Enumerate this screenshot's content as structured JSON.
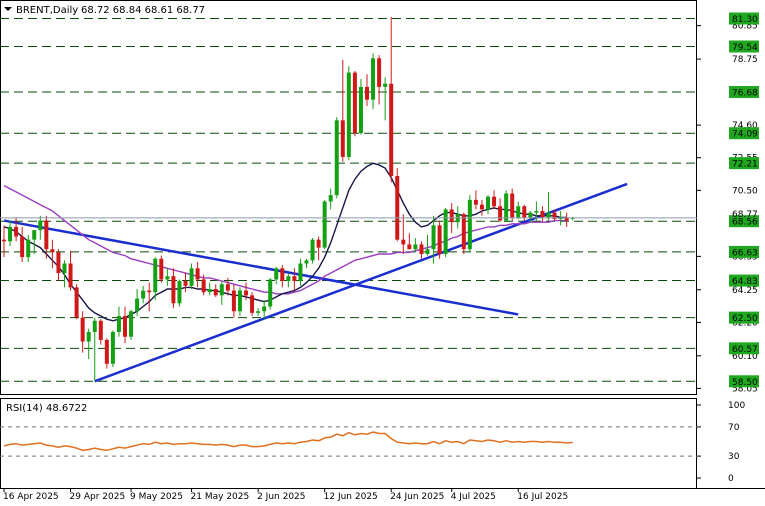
{
  "header": {
    "symbol_label": "BRENT,Daily",
    "ohlc": "68.72 68.84 68.61 68.77"
  },
  "rsi_panel": {
    "label": "RSI(14) 48.6722"
  },
  "colors": {
    "up": "#13a013",
    "down": "#d01818",
    "trendline": "#1a2ed0",
    "ma_fast": "#151548",
    "ma_slow": "#9a3cc0",
    "rsi": "#e07020",
    "level_line": "#0a4a0a",
    "tag_bg": "#1fa81f"
  },
  "chart_data": {
    "type": "candlestick",
    "title": "BRENT,Daily",
    "y_axis_price_ticks": [
      "80.85",
      "78.75",
      "74.60",
      "72.55",
      "70.50",
      "66.35",
      "64.25",
      "62.20",
      "60.10",
      "58.05"
    ],
    "level_tags": [
      "81.30",
      "79.54",
      "76.68",
      "74.09",
      "72.21",
      "68.56",
      "66.63",
      "64.83",
      "62.50",
      "60.57",
      "58.50"
    ],
    "levels": [
      81.3,
      79.54,
      76.68,
      74.09,
      72.21,
      68.56,
      66.63,
      64.83,
      62.5,
      60.57,
      58.5
    ],
    "current_price_label": "68.77",
    "x_tick_labels": [
      "16 Apr 2025",
      "29 Apr 2025",
      "9 May 2025",
      "21 May 2025",
      "2 Jun 2025",
      "12 Jun 2025",
      "24 Jun 2025",
      "4 Jul 2025",
      "16 Jul 2025"
    ],
    "ohlc": [
      [
        67.4,
        68.3,
        66.3,
        67.3
      ],
      [
        67.3,
        68.6,
        67.0,
        68.2
      ],
      [
        68.2,
        68.8,
        67.3,
        67.6
      ],
      [
        67.6,
        68.2,
        66.0,
        66.3
      ],
      [
        66.3,
        67.7,
        66.0,
        67.4
      ],
      [
        67.4,
        68.0,
        66.5,
        68.0
      ],
      [
        68.0,
        68.9,
        67.4,
        68.6
      ],
      [
        68.6,
        68.9,
        66.2,
        66.8
      ],
      [
        66.8,
        67.4,
        65.6,
        66.6
      ],
      [
        66.6,
        66.8,
        64.8,
        65.3
      ],
      [
        65.3,
        66.1,
        64.4,
        65.9
      ],
      [
        65.9,
        66.7,
        64.2,
        64.4
      ],
      [
        64.4,
        64.6,
        62.4,
        62.5
      ],
      [
        62.5,
        62.9,
        60.3,
        61.0
      ],
      [
        61.0,
        61.8,
        59.9,
        61.6
      ],
      [
        61.6,
        62.5,
        58.5,
        62.3
      ],
      [
        62.3,
        62.4,
        60.8,
        61.1
      ],
      [
        61.1,
        61.2,
        59.3,
        59.6
      ],
      [
        59.6,
        61.7,
        59.4,
        61.6
      ],
      [
        61.6,
        63.2,
        61.3,
        62.6
      ],
      [
        62.6,
        63.2,
        60.9,
        61.3
      ],
      [
        61.3,
        63.0,
        61.1,
        62.9
      ],
      [
        62.9,
        64.3,
        62.6,
        63.7
      ],
      [
        63.7,
        64.5,
        63.4,
        64.2
      ],
      [
        64.2,
        64.7,
        62.9,
        64.1
      ],
      [
        64.1,
        66.3,
        63.6,
        66.2
      ],
      [
        66.2,
        66.4,
        64.7,
        64.9
      ],
      [
        64.9,
        65.6,
        64.5,
        65.1
      ],
      [
        65.1,
        65.6,
        63.1,
        63.4
      ],
      [
        63.4,
        64.9,
        63.2,
        64.8
      ],
      [
        64.8,
        65.3,
        64.1,
        64.5
      ],
      [
        64.5,
        65.9,
        64.3,
        65.6
      ],
      [
        65.6,
        66.0,
        64.4,
        64.9
      ],
      [
        64.9,
        65.2,
        63.9,
        64.1
      ],
      [
        64.1,
        64.7,
        63.9,
        64.3
      ],
      [
        64.3,
        64.6,
        63.8,
        63.9
      ],
      [
        63.9,
        64.8,
        63.3,
        64.6
      ],
      [
        64.6,
        65.0,
        63.9,
        64.2
      ],
      [
        64.2,
        64.6,
        62.5,
        62.9
      ],
      [
        62.9,
        64.4,
        62.6,
        64.2
      ],
      [
        64.2,
        64.7,
        63.6,
        63.9
      ],
      [
        63.9,
        64.1,
        62.6,
        62.8
      ],
      [
        62.8,
        63.1,
        62.6,
        62.9
      ],
      [
        62.9,
        63.6,
        62.4,
        63.2
      ],
      [
        63.2,
        65.0,
        63.0,
        64.9
      ],
      [
        64.9,
        65.7,
        64.6,
        65.6
      ],
      [
        65.6,
        65.8,
        64.4,
        64.8
      ],
      [
        64.8,
        65.3,
        64.4,
        65.1
      ],
      [
        65.1,
        65.6,
        64.2,
        64.8
      ],
      [
        64.8,
        66.2,
        64.5,
        65.9
      ],
      [
        65.9,
        66.2,
        65.6,
        66.1
      ],
      [
        66.1,
        67.5,
        65.9,
        67.4
      ],
      [
        67.4,
        67.6,
        66.1,
        66.9
      ],
      [
        66.9,
        69.9,
        66.8,
        69.8
      ],
      [
        69.8,
        70.6,
        69.3,
        70.2
      ],
      [
        70.2,
        75.1,
        70.0,
        74.9
      ],
      [
        74.9,
        78.7,
        72.3,
        72.6
      ],
      [
        72.6,
        78.3,
        72.4,
        77.9
      ],
      [
        77.9,
        78.0,
        73.9,
        74.1
      ],
      [
        74.1,
        77.5,
        74.0,
        77.0
      ],
      [
        77.0,
        77.8,
        75.8,
        76.2
      ],
      [
        76.2,
        79.1,
        75.6,
        78.8
      ],
      [
        78.8,
        79.0,
        75.9,
        77.0
      ],
      [
        77.0,
        77.6,
        74.9,
        77.2
      ],
      [
        77.2,
        81.4,
        71.0,
        71.4
      ],
      [
        71.4,
        71.9,
        67.3,
        67.4
      ],
      [
        67.4,
        69.0,
        66.5,
        67.1
      ],
      [
        67.1,
        67.8,
        66.8,
        66.8
      ],
      [
        66.8,
        67.5,
        66.6,
        67.1
      ],
      [
        67.1,
        67.3,
        66.2,
        66.5
      ],
      [
        66.5,
        67.7,
        66.4,
        66.8
      ],
      [
        66.8,
        68.9,
        65.9,
        68.3
      ],
      [
        68.3,
        68.6,
        66.2,
        66.5
      ],
      [
        66.5,
        69.4,
        66.3,
        69.3
      ],
      [
        69.3,
        69.7,
        67.8,
        68.5
      ],
      [
        68.5,
        69.5,
        68.1,
        69.0
      ],
      [
        69.0,
        69.1,
        66.5,
        66.8
      ],
      [
        66.8,
        70.2,
        66.6,
        69.9
      ],
      [
        69.9,
        70.5,
        69.3,
        69.6
      ],
      [
        69.6,
        69.9,
        68.9,
        69.3
      ],
      [
        69.3,
        70.2,
        69.0,
        70.1
      ],
      [
        70.1,
        70.5,
        69.3,
        69.5
      ],
      [
        69.5,
        70.0,
        68.5,
        68.6
      ],
      [
        68.6,
        70.5,
        68.5,
        70.3
      ],
      [
        70.3,
        70.6,
        68.6,
        68.8
      ],
      [
        68.8,
        69.8,
        68.7,
        69.5
      ],
      [
        69.5,
        69.6,
        68.6,
        68.8
      ],
      [
        68.8,
        69.2,
        68.5,
        69.1
      ],
      [
        69.1,
        69.8,
        68.6,
        69.2
      ],
      [
        69.2,
        69.5,
        68.5,
        68.8
      ],
      [
        68.8,
        70.4,
        68.6,
        69.1
      ],
      [
        69.1,
        69.3,
        68.6,
        68.7
      ],
      [
        68.7,
        69.2,
        68.3,
        68.8
      ],
      [
        68.8,
        69.1,
        68.2,
        68.6
      ],
      [
        68.72,
        68.84,
        68.61,
        68.77
      ]
    ],
    "rsi": {
      "name": "RSI(14)",
      "value": 48.6722,
      "levels": [
        70,
        30
      ],
      "ticks": [
        "100",
        "70",
        "30",
        "0"
      ],
      "values": [
        44,
        46,
        47,
        45,
        46,
        47,
        48,
        45,
        44,
        42,
        44,
        43,
        41,
        38,
        39,
        41,
        39,
        38,
        40,
        42,
        41,
        43,
        45,
        47,
        46,
        49,
        47,
        48,
        46,
        47,
        47,
        48,
        47,
        46,
        46,
        45,
        46,
        45,
        43,
        45,
        45,
        43,
        43,
        44,
        46,
        48,
        47,
        48,
        47,
        49,
        50,
        52,
        51,
        55,
        56,
        60,
        58,
        62,
        59,
        61,
        60,
        63,
        61,
        61,
        54,
        49,
        48,
        47,
        48,
        47,
        47,
        50,
        47,
        51,
        49,
        50,
        47,
        52,
        51,
        50,
        52,
        51,
        49,
        51,
        49,
        50,
        49,
        50,
        50,
        49,
        50,
        49,
        49,
        48,
        48.6722
      ]
    },
    "ma_fast": [
      68.2,
      68.1,
      67.9,
      67.6,
      67.3,
      67.1,
      66.9,
      66.5,
      66.1,
      65.7,
      65.2,
      64.6,
      64.1,
      63.6,
      63.1,
      62.8,
      62.6,
      62.4,
      62.3,
      62.4,
      62.5,
      62.7,
      62.9,
      63.2,
      63.5,
      63.9,
      64.1,
      64.3,
      64.3,
      64.3,
      64.4,
      64.4,
      64.3,
      64.3,
      64.2,
      64.2,
      64.1,
      64.0,
      63.9,
      63.9,
      63.8,
      63.7,
      63.6,
      63.5,
      63.6,
      63.8,
      64.0,
      64.1,
      64.2,
      64.4,
      64.7,
      65.1,
      65.6,
      66.3,
      67.2,
      68.3,
      69.4,
      70.5,
      71.2,
      71.7,
      72.0,
      72.2,
      72.1,
      71.9,
      71.3,
      70.5,
      69.7,
      69.0,
      68.5,
      68.2,
      68.3,
      68.6,
      68.9,
      69.1,
      69.1,
      69.0,
      68.9,
      68.9,
      69.0,
      69.2,
      69.3,
      69.4,
      69.3,
      69.3,
      69.2,
      69.1,
      69.0,
      69.0,
      68.9,
      68.9,
      68.9,
      68.9,
      68.8,
      68.8
    ],
    "ma_slow": [
      70.8,
      70.6,
      70.4,
      70.2,
      70.0,
      69.8,
      69.6,
      69.4,
      69.2,
      68.9,
      68.6,
      68.3,
      68.0,
      67.7,
      67.4,
      67.2,
      67.0,
      66.8,
      66.6,
      66.5,
      66.4,
      66.2,
      66.1,
      66.0,
      65.9,
      65.8,
      65.7,
      65.6,
      65.5,
      65.4,
      65.3,
      65.2,
      65.1,
      65.0,
      65.0,
      64.9,
      64.8,
      64.7,
      64.6,
      64.5,
      64.4,
      64.3,
      64.2,
      64.1,
      64.1,
      64.0,
      64.0,
      64.0,
      64.1,
      64.2,
      64.4,
      64.6,
      64.8,
      65.1,
      65.3,
      65.5,
      65.7,
      65.9,
      66.1,
      66.2,
      66.3,
      66.4,
      66.5,
      66.5,
      66.5,
      66.6,
      66.6,
      66.6,
      66.7,
      66.8,
      66.9,
      67.0,
      67.2,
      67.3,
      67.5,
      67.6,
      67.8,
      67.9,
      68.0,
      68.1,
      68.2,
      68.2,
      68.3,
      68.3,
      68.4,
      68.4,
      68.4,
      68.5,
      68.5,
      68.5,
      68.5,
      68.6,
      68.6,
      68.6
    ],
    "trendlines": [
      {
        "from": [
          0,
          68.6
        ],
        "to": [
          85,
          62.7
        ]
      },
      {
        "from": [
          15,
          58.5
        ],
        "to": [
          103,
          70.9
        ]
      }
    ]
  }
}
